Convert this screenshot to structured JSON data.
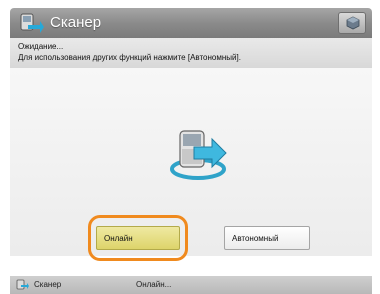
{
  "titlebar": {
    "title": "Сканер",
    "app_icon": "scanner-icon",
    "settings_icon": "settings-cube-icon"
  },
  "message": {
    "line1": "Ожидание...",
    "line2": "Для использования других функций нажмите [Автономный]."
  },
  "content": {
    "graphic_icon": "scanner-arrow-icon"
  },
  "buttons": {
    "online_label": "Онлайн",
    "offline_label": "Автономный",
    "selected": "online"
  },
  "statusbar": {
    "app_label": "Сканер",
    "status_text": "Онлайн..."
  },
  "colors": {
    "titlebar": "#8b8b8b",
    "highlight": "#f08a1e",
    "online_button": "#e6dd83"
  }
}
